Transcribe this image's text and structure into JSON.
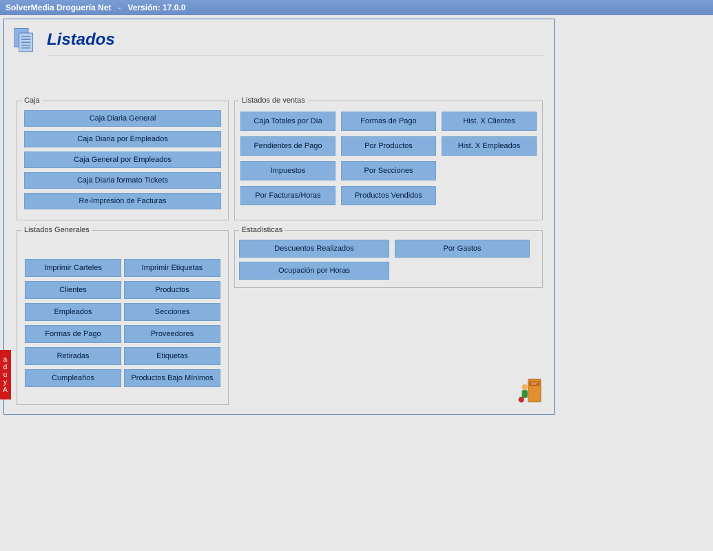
{
  "titlebar": {
    "app_name": "SolverMedia Droguería Net",
    "separator": "-",
    "version_label": "Versión: 17.0.0"
  },
  "header": {
    "title": "Listados"
  },
  "groups": {
    "caja": {
      "legend": "Caja",
      "buttons": [
        "Caja Diaria General",
        "Caja Diaria por Empleados",
        "Caja General por Empleados",
        "Caja Diaria formato Tickets",
        "Re-Impresión de Facturas"
      ]
    },
    "generales": {
      "legend": "Listados Generales",
      "rows": [
        [
          "Imprimir Carteles",
          "Imprimir Etiquetas"
        ],
        [
          "Clientes",
          "Productos"
        ],
        [
          "Empleados",
          "Secciones"
        ],
        [
          "Formas de Pago",
          "Proveedores"
        ],
        [
          "Retiradas",
          "Etiquetas"
        ],
        [
          "Cumpleaños",
          "Productos Bajo Mínimos"
        ]
      ]
    },
    "ventas": {
      "legend": "Listados de ventas",
      "cells": [
        "Caja Totales por Día",
        "Formas de Pago",
        "Hist. X Clientes",
        "Pendientes de Pago",
        "Por Productos",
        "Hist. X Empleados",
        "Impuestos",
        "Por Secciones",
        "",
        "Por Facturas/Horas",
        "Productos Vendidos",
        ""
      ]
    },
    "stats": {
      "legend": "Estadísticas",
      "descuentos": "Descuentos Realizados",
      "gastos": "Por Gastos",
      "ocupacion": "Ocupación por Horas"
    }
  },
  "sidebar": {
    "ayuda": "Ayuda"
  }
}
